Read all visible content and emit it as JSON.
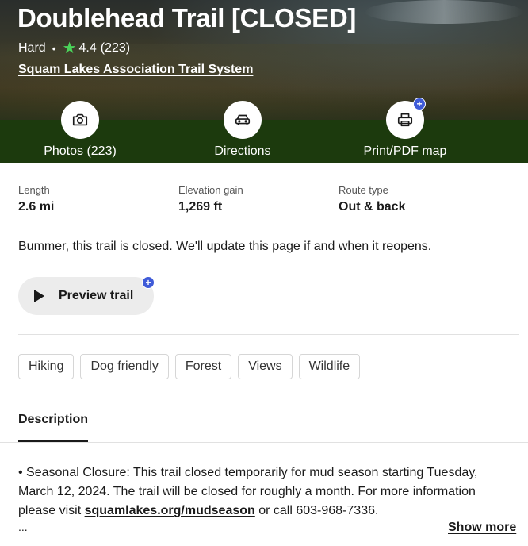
{
  "trail": {
    "title": "Doublehead Trail [CLOSED]",
    "difficulty": "Hard",
    "separator": "•",
    "rating": "4.4",
    "review_count": "(223)",
    "park": "Squam Lakes Association Trail System"
  },
  "actions": [
    {
      "label": "Photos (223)",
      "icon": "camera-icon",
      "premium": false
    },
    {
      "label": "Directions",
      "icon": "car-icon",
      "premium": false
    },
    {
      "label": "Print/PDF map",
      "icon": "printer-icon",
      "premium": true
    }
  ],
  "stats": [
    {
      "label": "Length",
      "value": "2.6 mi"
    },
    {
      "label": "Elevation gain",
      "value": "1,269 ft"
    },
    {
      "label": "Route type",
      "value": "Out & back"
    }
  ],
  "closed_message": "Bummer, this trail is closed. We'll update this page if and when it reopens.",
  "preview": {
    "label": "Preview trail",
    "premium_badge": "+"
  },
  "tags": [
    "Hiking",
    "Dog friendly",
    "Forest",
    "Views",
    "Wildlife"
  ],
  "description": {
    "tab_label": "Description",
    "text_before_link": "• Seasonal Closure: This trail closed temporarily for mud season starting Tuesday, March 12, 2024. The trail will be closed for roughly a month. For more information please visit ",
    "link_text": "squamlakes.org/mudseason",
    "text_after_link": " or call 603-968-7336.",
    "ellipsis": "...",
    "show_more": "Show more"
  },
  "colors": {
    "action_band": "#1c3a0d",
    "star": "#4bd35a",
    "premium_badge": "#3f5bd8"
  }
}
